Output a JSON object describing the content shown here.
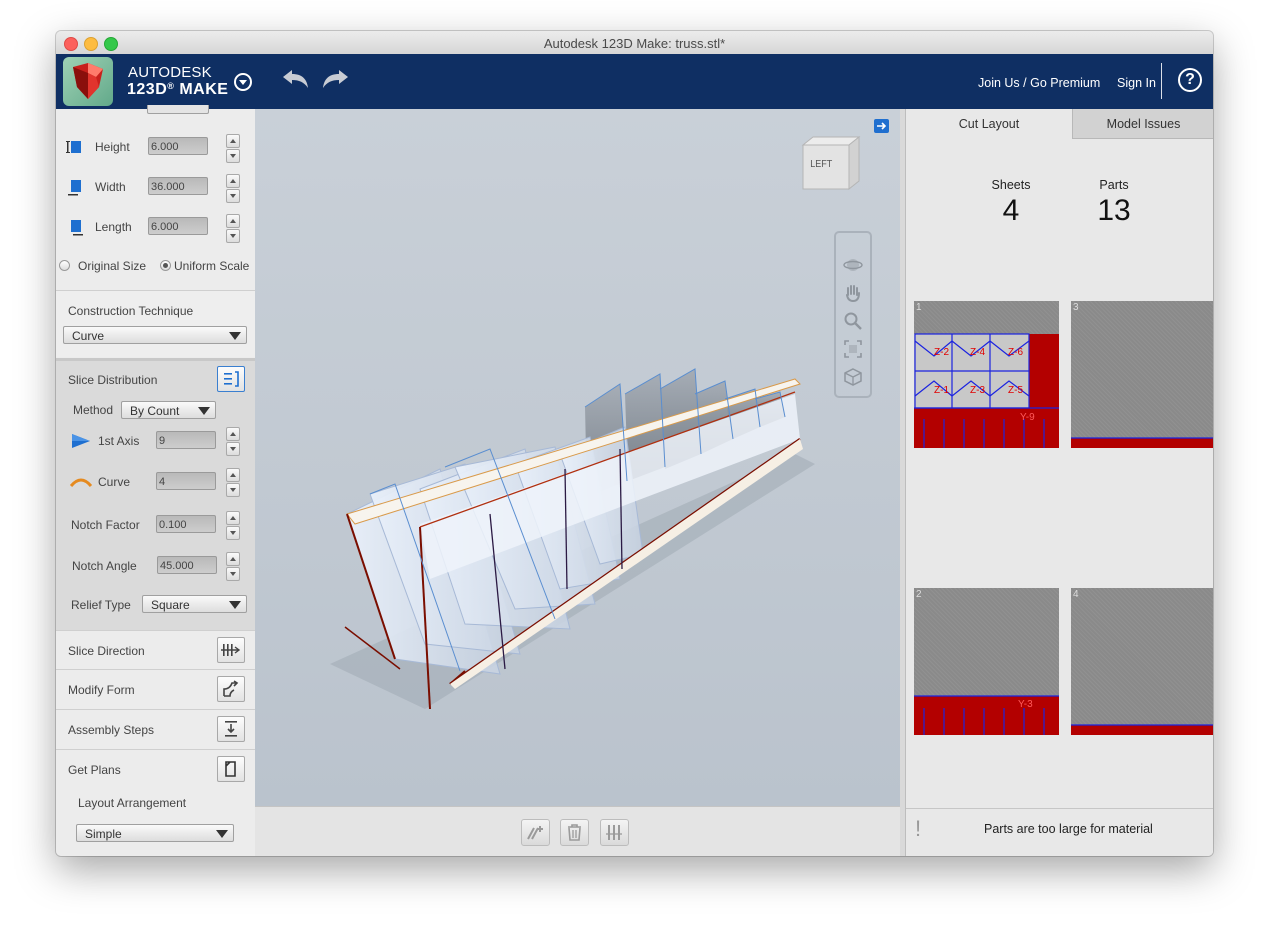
{
  "window": {
    "title": "Autodesk 123D Make: truss.stl*"
  },
  "header": {
    "brand_line1": "AUTODESK",
    "brand_line2": "123D",
    "brand_line3": "MAKE",
    "join_label": "Join Us / Go Premium",
    "signin_label": "Sign In",
    "help_label": "?"
  },
  "dimensions": {
    "height": {
      "label": "Height",
      "value": "6.000"
    },
    "width": {
      "label": "Width",
      "value": "36.000"
    },
    "length": {
      "label": "Length",
      "value": "6.000"
    },
    "original_size_label": "Original Size",
    "uniform_scale_label": "Uniform Scale",
    "selected_scale": "Uniform Scale"
  },
  "construction": {
    "label": "Construction Technique",
    "value": "Curve"
  },
  "slice_distribution": {
    "label": "Slice Distribution",
    "method_label": "Method",
    "method_value": "By Count",
    "axis1_label": "1st Axis",
    "axis1_value": "9",
    "curve_label": "Curve",
    "curve_value": "4",
    "notch_factor_label": "Notch Factor",
    "notch_factor_value": "0.100",
    "notch_angle_label": "Notch Angle",
    "notch_angle_value": "45.000",
    "relief_type_label": "Relief Type",
    "relief_type_value": "Square"
  },
  "sections": {
    "slice_direction": "Slice Direction",
    "modify_form": "Modify Form",
    "assembly_steps": "Assembly Steps",
    "get_plans": "Get Plans",
    "layout_arrangement_label": "Layout Arrangement",
    "layout_arrangement_value": "Simple"
  },
  "viewcube": {
    "face_label": "LEFT"
  },
  "right_panel": {
    "tabs": [
      "Cut Layout",
      "Model Issues"
    ],
    "active_tab": "Cut Layout",
    "sheets_label": "Sheets",
    "sheets_value": "4",
    "parts_label": "Parts",
    "parts_value": "13",
    "sheets": [
      {
        "number": "1",
        "parts": [
          "Z-2",
          "Z-4",
          "Z-6",
          "Z-1",
          "Z-3",
          "Z-5",
          "Y-9"
        ]
      },
      {
        "number": "3",
        "parts": []
      },
      {
        "number": "2",
        "parts": [
          "Y-3"
        ]
      },
      {
        "number": "4",
        "parts": []
      }
    ],
    "message": "Parts are too large for material",
    "message_icon": "!"
  },
  "colors": {
    "appbar": "#0f2f63",
    "part_red": "#b30000",
    "slice_outline": "#7a0e00",
    "accent_blue": "#1f6fcf"
  }
}
